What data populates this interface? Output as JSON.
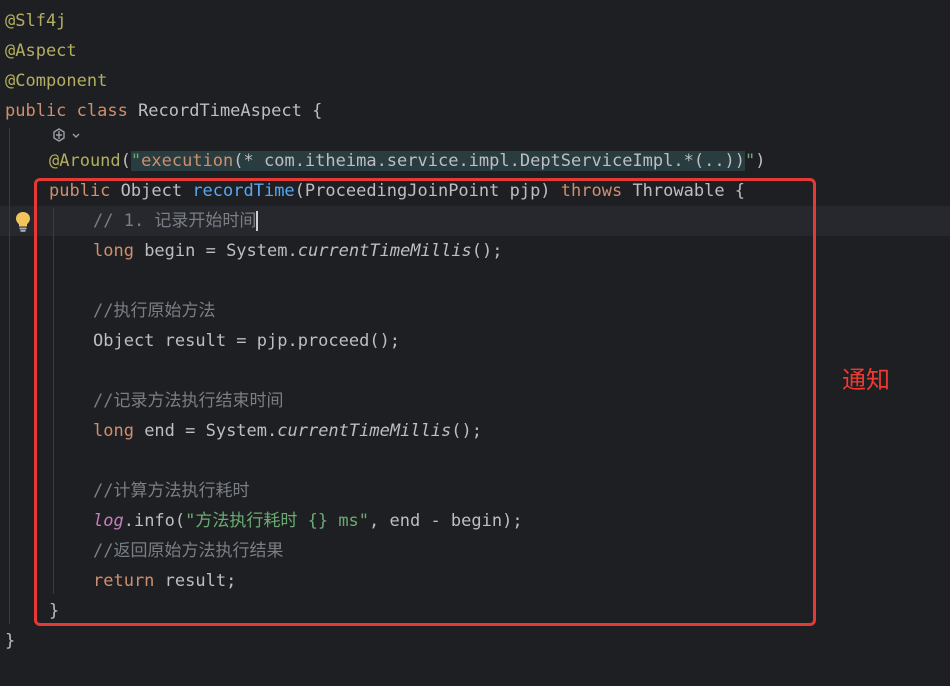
{
  "editor": {
    "lines": [
      {
        "text": "@Slf4j"
      },
      {
        "text": "@Aspect"
      },
      {
        "text": "@Component"
      },
      {
        "kw1": "public class ",
        "name": "RecordTimeAspect",
        "rest": " {"
      },
      {
        "icon": "ai-assistant-icon"
      },
      {
        "ann": "@Around",
        "p1": "(",
        "q1": "\"",
        "pointcut_kw": "execution",
        "pointcut": "(* com.itheima.service.impl.DeptServiceImpl.*(..))",
        "q2": "\"",
        "p2": ")"
      },
      {
        "kw1": "public ",
        "t1": "Object ",
        "fn": "recordTime",
        "t2": "(ProceedingJoinPoint pjp) ",
        "kw2": "throws",
        "t3": " Throwable {"
      },
      {
        "comment": "// 1. 记录开始时间"
      },
      {
        "kw1": "long",
        "t1": " begin = System.",
        "it": "currentTimeMillis",
        "t2": "();"
      },
      {
        "comment": "//执行原始方法"
      },
      {
        "text": "Object result = pjp.proceed();"
      },
      {
        "comment": "//记录方法执行结束时间"
      },
      {
        "kw1": "long",
        "t1": " end = System.",
        "it": "currentTimeMillis",
        "t2": "();"
      },
      {
        "comment": "//计算方法执行耗时"
      },
      {
        "field": "log",
        "t1": ".info(",
        "str": "\"方法执行耗时 {} ms\"",
        "t2": ", end - begin);"
      },
      {
        "comment": "//返回原始方法执行结果"
      },
      {
        "kw1": "return",
        "t1": " result;"
      },
      {
        "text": "}"
      },
      {
        "text": "}"
      }
    ]
  },
  "annotation": {
    "label": "通知",
    "color": "#e53935"
  },
  "gutter": {
    "icon": "lightbulb-icon"
  }
}
